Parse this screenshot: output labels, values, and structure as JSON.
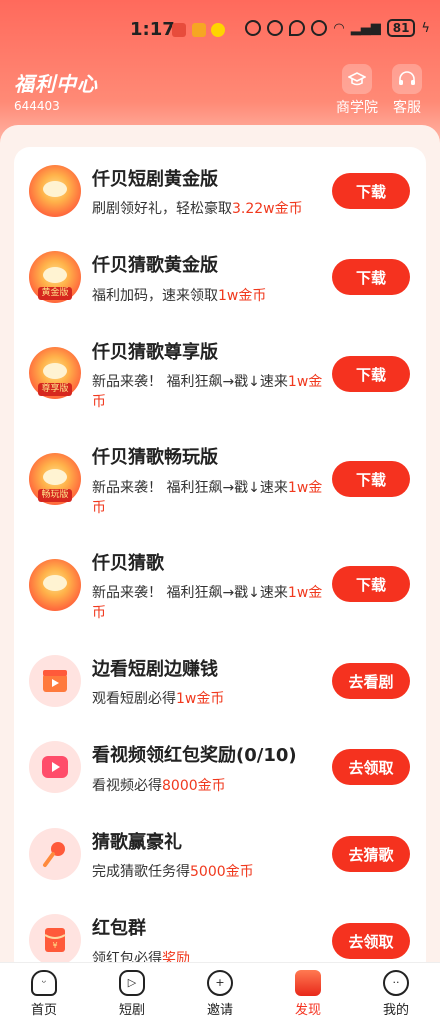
{
  "status": {
    "time": "1:17",
    "battery": "81"
  },
  "header": {
    "title": "福利中心",
    "user_id": "644403",
    "actions": [
      {
        "label": "商学院",
        "icon": "graduation-cap-icon"
      },
      {
        "label": "客服",
        "icon": "headset-icon"
      }
    ]
  },
  "tasks": [
    {
      "title": "仟贝短剧黄金版",
      "desc_prefix": "刷剧领好礼，轻松豪取",
      "desc_highlight": "3.22w金币",
      "button": "下载",
      "icon": "shell-app-icon",
      "tag": ""
    },
    {
      "title": "仟贝猜歌黄金版",
      "desc_prefix": "福利加码，速来领取",
      "desc_highlight": "1w金币",
      "button": "下载",
      "icon": "shell-app-icon",
      "tag": "黄金版"
    },
    {
      "title": "仟贝猜歌尊享版",
      "desc_prefix": "新品来袭！ 福利狂飙→戳↓速来",
      "desc_highlight": "1w金币",
      "button": "下载",
      "icon": "shell-app-icon",
      "tag": "尊享版"
    },
    {
      "title": "仟贝猜歌畅玩版",
      "desc_prefix": "新品来袭！ 福利狂飙→戳↓速来",
      "desc_highlight": "1w金币",
      "button": "下载",
      "icon": "shell-app-icon",
      "tag": "畅玩版"
    },
    {
      "title": "仟贝猜歌",
      "desc_prefix": "新品来袭！ 福利狂飙→戳↓速来",
      "desc_highlight": "1w金币",
      "button": "下载",
      "icon": "shell-app-icon",
      "tag": ""
    },
    {
      "title": "边看短剧边赚钱",
      "desc_prefix": "观看短剧必得",
      "desc_highlight": "1w金币",
      "button": "去看剧",
      "icon": "clapperboard-icon",
      "tag": ""
    },
    {
      "title": "看视频领红包奖励(0/10)",
      "desc_prefix": "看视频必得",
      "desc_highlight": "8000金币",
      "button": "去领取",
      "icon": "play-video-icon",
      "tag": ""
    },
    {
      "title": "猜歌赢豪礼",
      "desc_prefix": "完成猜歌任务得",
      "desc_highlight": "5000金币",
      "button": "去猜歌",
      "icon": "microphone-icon",
      "tag": ""
    },
    {
      "title": "红包群",
      "desc_prefix": "领红包必得",
      "desc_highlight": "奖励",
      "button": "去领取",
      "icon": "red-envelope-icon",
      "tag": ""
    }
  ],
  "nav": [
    {
      "label": "首页",
      "icon": "home-icon"
    },
    {
      "label": "短剧",
      "icon": "play-tv-icon"
    },
    {
      "label": "邀请",
      "icon": "invite-icon"
    },
    {
      "label": "发现",
      "icon": "discover-gift-icon"
    },
    {
      "label": "我的",
      "icon": "profile-icon"
    }
  ],
  "colors": {
    "accent": "#f5321f",
    "highlight": "#f0391e",
    "header": "#ff6a5c"
  }
}
